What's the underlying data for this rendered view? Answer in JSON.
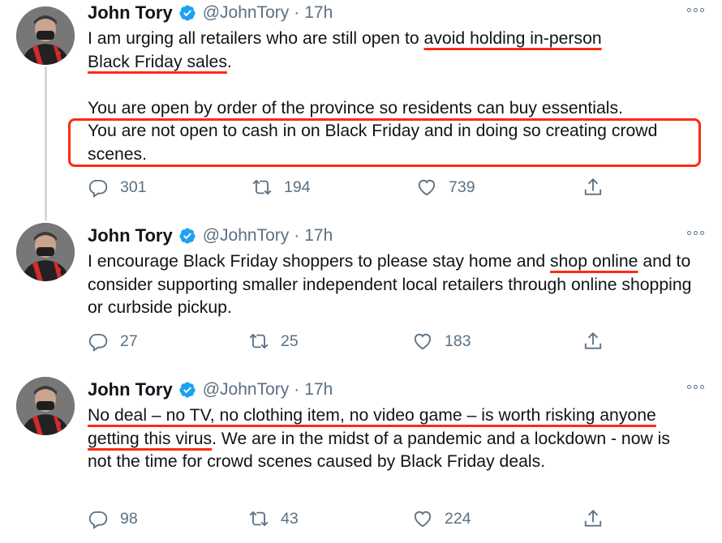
{
  "tweets": [
    {
      "author": {
        "name": "John Tory",
        "handle": "@JohnTory",
        "separator": "·",
        "time": "17h"
      },
      "text": {
        "line1_pre": "I am urging all retailers who are still open to ",
        "line1_ul": "avoid holding in-person",
        "line2_ul": "Black Friday sales",
        "line2_post": ".",
        "para2_line1": "You are open by order of the province so residents can buy essentials.",
        "para2_boxed": "You are not open to cash in on Black Friday and in doing so creating crowd scenes."
      },
      "actions": {
        "replies": "301",
        "retweets": "194",
        "likes": "739"
      }
    },
    {
      "author": {
        "name": "John Tory",
        "handle": "@JohnTory",
        "separator": "·",
        "time": "17h"
      },
      "text": {
        "pre": "I encourage Black Friday shoppers to please stay home and ",
        "ul": "shop online",
        "post": " and to consider supporting smaller independent local retailers through online shopping or curbside pickup."
      },
      "actions": {
        "replies": "27",
        "retweets": "25",
        "likes": "183"
      }
    },
    {
      "author": {
        "name": "John Tory",
        "handle": "@JohnTory",
        "separator": "·",
        "time": "17h"
      },
      "text": {
        "ul": "No deal – no TV, no clothing item, no video game – is worth risking anyone getting this virus",
        "post": ". We are in the midst of a pandemic and a lockdown - now is not the time for crowd scenes caused by Black Friday deals."
      },
      "actions": {
        "replies": "98",
        "retweets": "43",
        "likes": "224"
      }
    }
  ],
  "colors": {
    "highlight": "#ff2a12",
    "secondary_text": "#5b7083",
    "verified": "#1da1f2"
  },
  "icons": [
    "verified-badge-icon",
    "more-icon",
    "reply-icon",
    "retweet-icon",
    "like-icon",
    "share-icon"
  ]
}
